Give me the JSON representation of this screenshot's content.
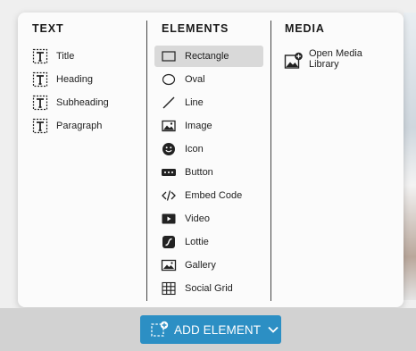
{
  "panel": {
    "text": {
      "heading": "TEXT",
      "items": [
        {
          "label": "Title",
          "icon": "text-t-icon"
        },
        {
          "label": "Heading",
          "icon": "text-t-icon"
        },
        {
          "label": "Subheading",
          "icon": "text-t-icon"
        },
        {
          "label": "Paragraph",
          "icon": "text-t-icon"
        }
      ]
    },
    "elements": {
      "heading": "ELEMENTS",
      "selected": "Rectangle",
      "items": [
        {
          "label": "Rectangle",
          "icon": "rectangle-icon"
        },
        {
          "label": "Oval",
          "icon": "oval-icon"
        },
        {
          "label": "Line",
          "icon": "line-icon"
        },
        {
          "label": "Image",
          "icon": "image-icon"
        },
        {
          "label": "Icon",
          "icon": "smiley-icon"
        },
        {
          "label": "Button",
          "icon": "button-icon"
        },
        {
          "label": "Embed Code",
          "icon": "code-icon"
        },
        {
          "label": "Video",
          "icon": "video-play-icon"
        },
        {
          "label": "Lottie",
          "icon": "lottie-icon"
        },
        {
          "label": "Gallery",
          "icon": "gallery-icon"
        },
        {
          "label": "Social Grid",
          "icon": "grid-icon"
        }
      ]
    },
    "media": {
      "heading": "MEDIA",
      "items": [
        {
          "label": "Open Media Library",
          "icon": "media-library-add-icon"
        }
      ]
    }
  },
  "bottom_bar": {
    "add_element_label": "ADD ELEMENT",
    "icon": "add-element-icon",
    "chevron": "chevron-down-icon"
  },
  "colors": {
    "accent": "#2c8fc4",
    "panel_bg": "#fbfbfb",
    "selected_bg": "#d9d9d9",
    "bar_bg": "#d2d2d2"
  }
}
